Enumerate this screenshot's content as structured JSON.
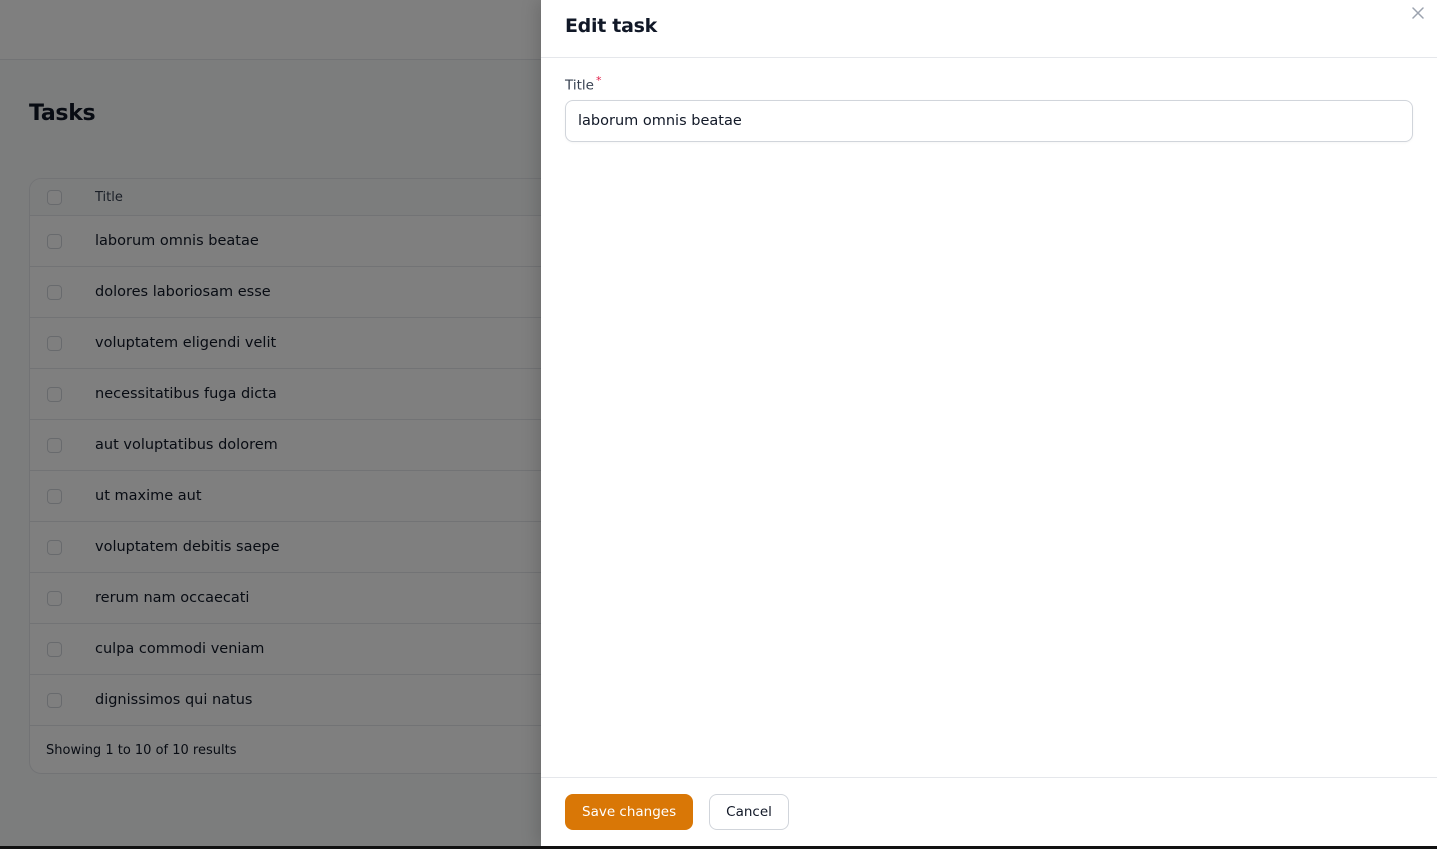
{
  "page": {
    "title": "Tasks",
    "table": {
      "column_title": "Title",
      "rows": [
        {
          "title": "laborum omnis beatae"
        },
        {
          "title": "dolores laboriosam esse"
        },
        {
          "title": "voluptatem eligendi velit"
        },
        {
          "title": "necessitatibus fuga dicta"
        },
        {
          "title": "aut voluptatibus dolorem"
        },
        {
          "title": "ut maxime aut"
        },
        {
          "title": "voluptatem debitis saepe"
        },
        {
          "title": "rerum nam occaecati"
        },
        {
          "title": "culpa commodi veniam"
        },
        {
          "title": "dignissimos qui natus"
        }
      ],
      "footer": "Showing 1 to 10 of 10 results"
    }
  },
  "modal": {
    "title": "Edit task",
    "close_icon": "x-icon",
    "fields": {
      "title": {
        "label": "Title",
        "required_marker": "*",
        "value": "laborum omnis beatae"
      }
    },
    "actions": {
      "save_label": "Save changes",
      "cancel_label": "Cancel"
    },
    "colors": {
      "primary": "#d97706",
      "required": "#e11d48"
    }
  }
}
